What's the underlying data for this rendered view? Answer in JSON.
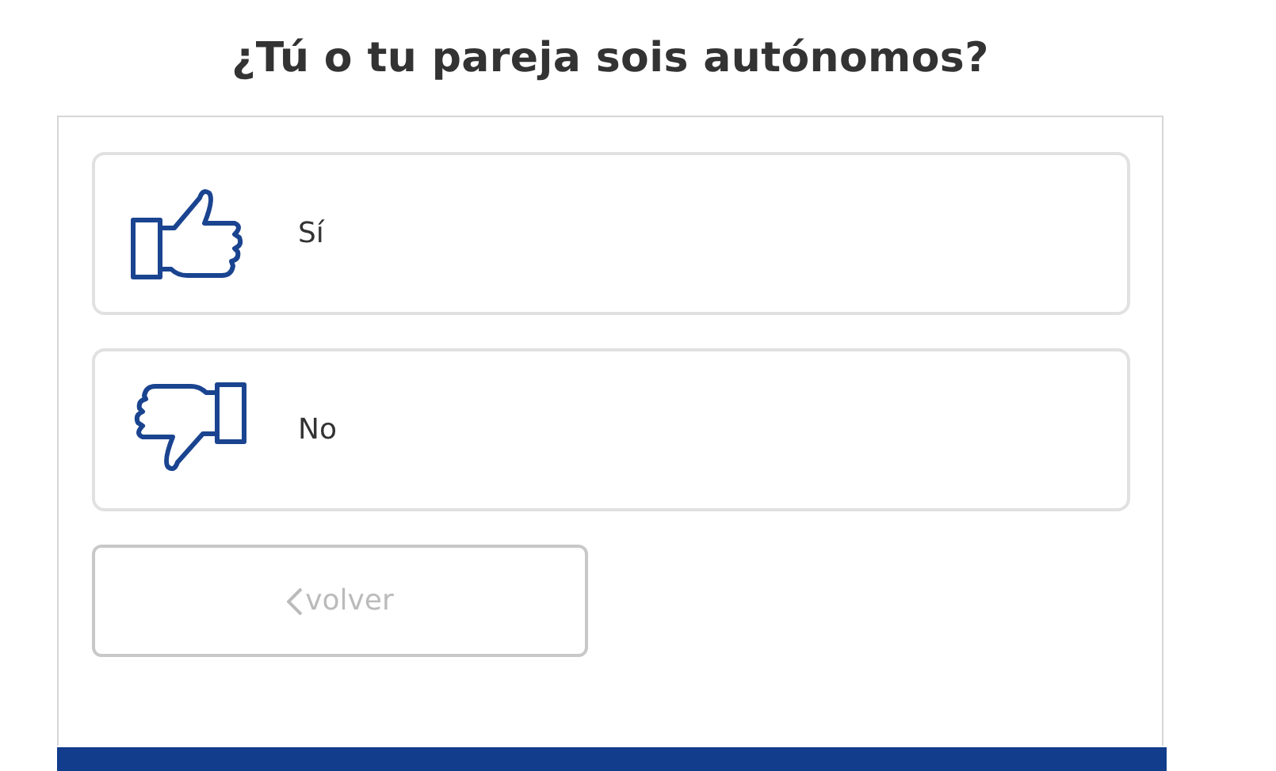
{
  "question": {
    "title": "¿Tú o tu pareja sois autónomos?"
  },
  "options": [
    {
      "kind": "yes",
      "label": "Sí"
    },
    {
      "kind": "no",
      "label": "No"
    }
  ],
  "back_button": {
    "label": "volver"
  }
}
